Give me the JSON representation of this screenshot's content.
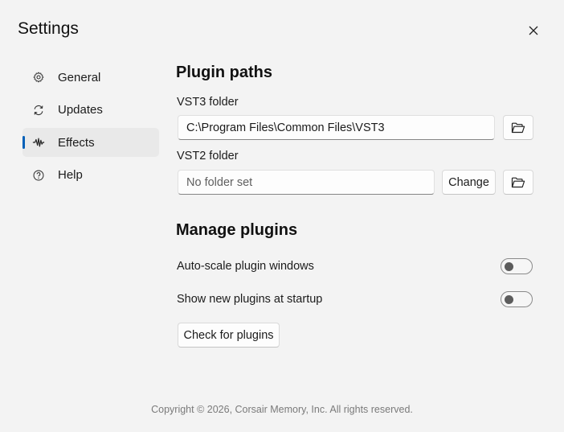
{
  "window": {
    "title": "Settings",
    "close_icon": "close-icon"
  },
  "sidebar": {
    "items": [
      {
        "label": "General",
        "icon": "gear-icon",
        "selected": false
      },
      {
        "label": "Updates",
        "icon": "refresh-icon",
        "selected": false
      },
      {
        "label": "Effects",
        "icon": "waveform-icon",
        "selected": true
      },
      {
        "label": "Help",
        "icon": "help-icon",
        "selected": false
      }
    ],
    "accent_color": "#005fb8"
  },
  "plugin_paths": {
    "title": "Plugin paths",
    "vst3": {
      "label": "VST3 folder",
      "value": "C:\\Program Files\\Common Files\\VST3",
      "browse_icon": "folder-open-icon"
    },
    "vst2": {
      "label": "VST2 folder",
      "value": "No folder set",
      "change_label": "Change",
      "browse_icon": "folder-open-icon"
    }
  },
  "manage_plugins": {
    "title": "Manage plugins",
    "auto_scale": {
      "label": "Auto-scale plugin windows",
      "on": false
    },
    "show_new": {
      "label": "Show new plugins at startup",
      "on": false
    },
    "check_button": "Check for plugins"
  },
  "footer": {
    "copyright": "Copyright © 2026, Corsair Memory, Inc. All rights reserved."
  }
}
